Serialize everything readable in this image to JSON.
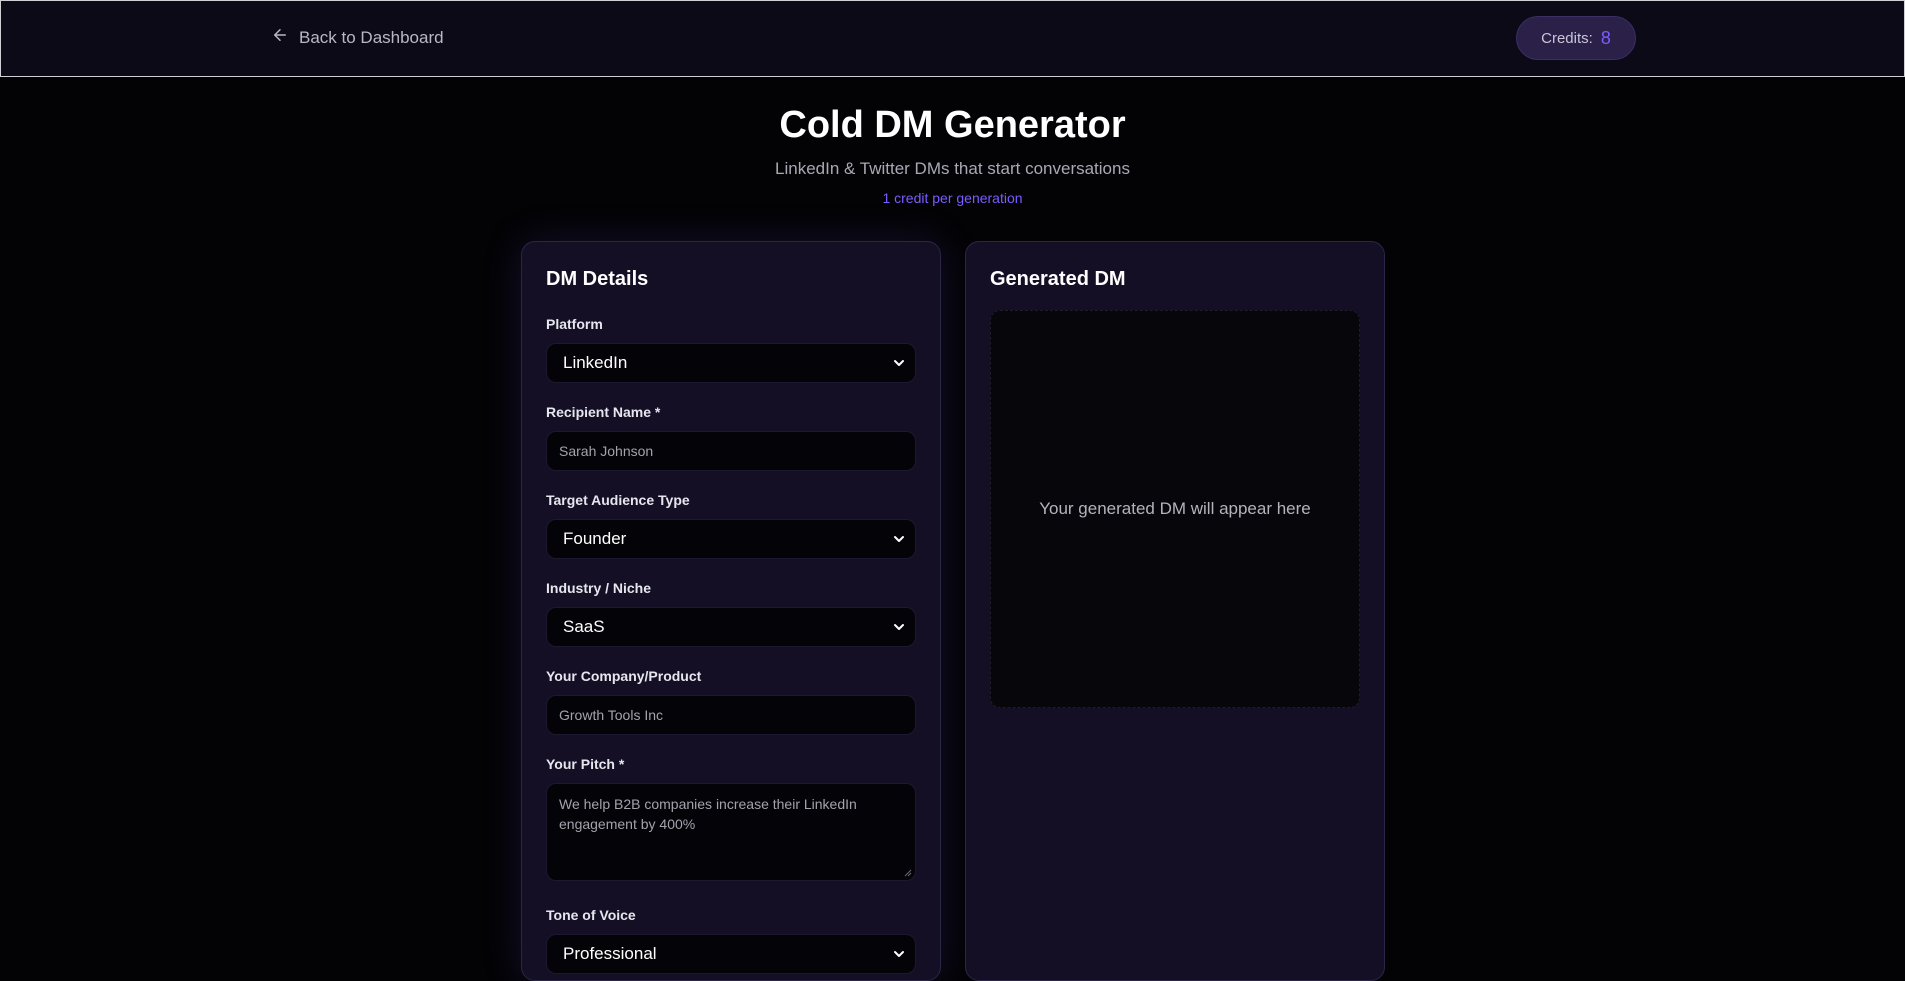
{
  "header": {
    "back_label": "Back to Dashboard",
    "back_icon": "arrow-left-icon",
    "credits_label": "Credits:",
    "credits_value": "8"
  },
  "page": {
    "title": "Cold DM Generator",
    "subtitle": "LinkedIn & Twitter DMs that start conversations",
    "credit_note": "1 credit per generation"
  },
  "form": {
    "heading": "DM Details",
    "platform_label": "Platform",
    "platform_value": "LinkedIn",
    "recipient_label": "Recipient Name *",
    "recipient_placeholder": "Sarah Johnson",
    "audience_label": "Target Audience Type",
    "audience_value": "Founder",
    "industry_label": "Industry / Niche",
    "industry_value": "SaaS",
    "company_label": "Your Company/Product",
    "company_placeholder": "Growth Tools Inc",
    "pitch_label": "Your Pitch *",
    "pitch_placeholder": "We help B2B companies increase their LinkedIn engagement by 400%",
    "tone_label": "Tone of Voice",
    "tone_value": "Professional"
  },
  "output": {
    "heading": "Generated DM",
    "placeholder": "Your generated DM will appear here"
  },
  "colors": {
    "accent": "#7c5cff",
    "background": "#030305",
    "panel": "#140f24"
  }
}
